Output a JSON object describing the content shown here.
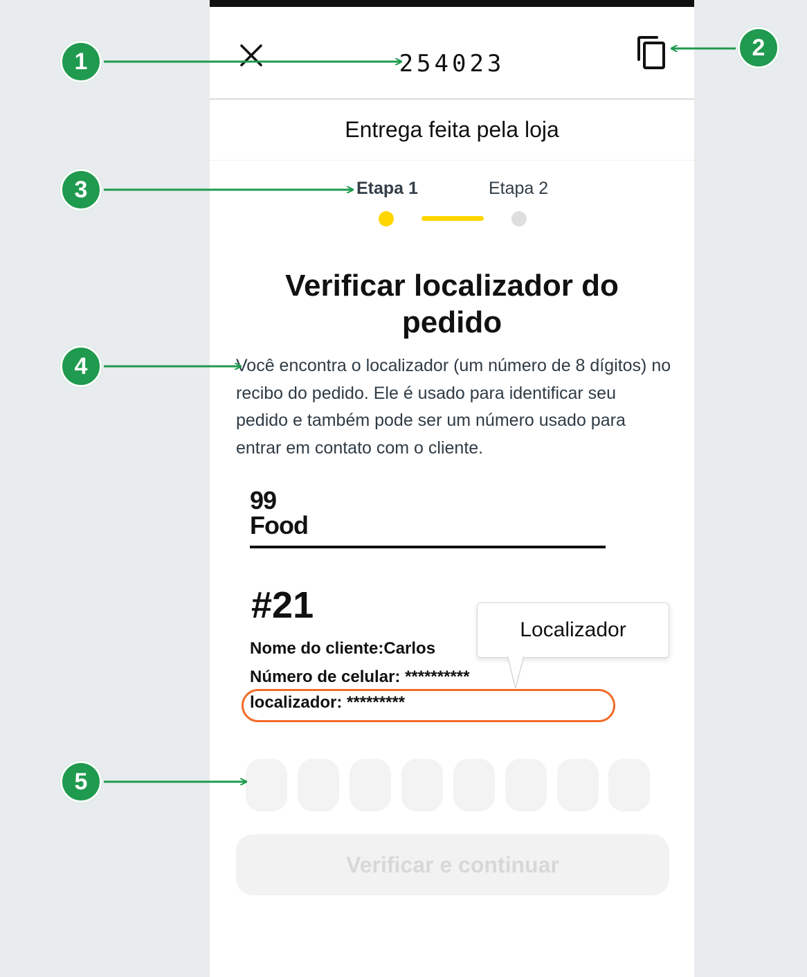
{
  "header": {
    "order_code": "254023",
    "close_icon": "close-icon",
    "copy_icon": "copy-icon"
  },
  "subtitle": "Entrega feita pela loja",
  "steps": [
    {
      "label": "Etapa 1",
      "active": true
    },
    {
      "label": "Etapa 2",
      "active": false
    }
  ],
  "title": "Verificar localizador do pedido",
  "description": "Você encontra o localizador (um número de 8 dígitos) no recibo do pedido. Ele é usado para identificar seu pedido e também pode ser um número usado para entrar em contato com o cliente.",
  "receipt": {
    "logo_line1": "99",
    "logo_line2": "Food",
    "order_number": "#21",
    "customer_line": "Nome do cliente:Carlos",
    "phone_line": "Número de celular: **********",
    "locator_line": "localizador: *********",
    "tooltip": "Localizador"
  },
  "code_input": {
    "digits": [
      "",
      "",
      "",
      "",
      "",
      "",
      "",
      ""
    ]
  },
  "primary_button": "Verificar e continuar",
  "callouts": [
    "1",
    "2",
    "3",
    "4",
    "5"
  ],
  "colors": {
    "accent_yellow": "#ffd600",
    "callout_green": "#1f9a4e",
    "highlight_orange": "#f26b2a",
    "disabled_button_bg": "#f2f2f3"
  }
}
